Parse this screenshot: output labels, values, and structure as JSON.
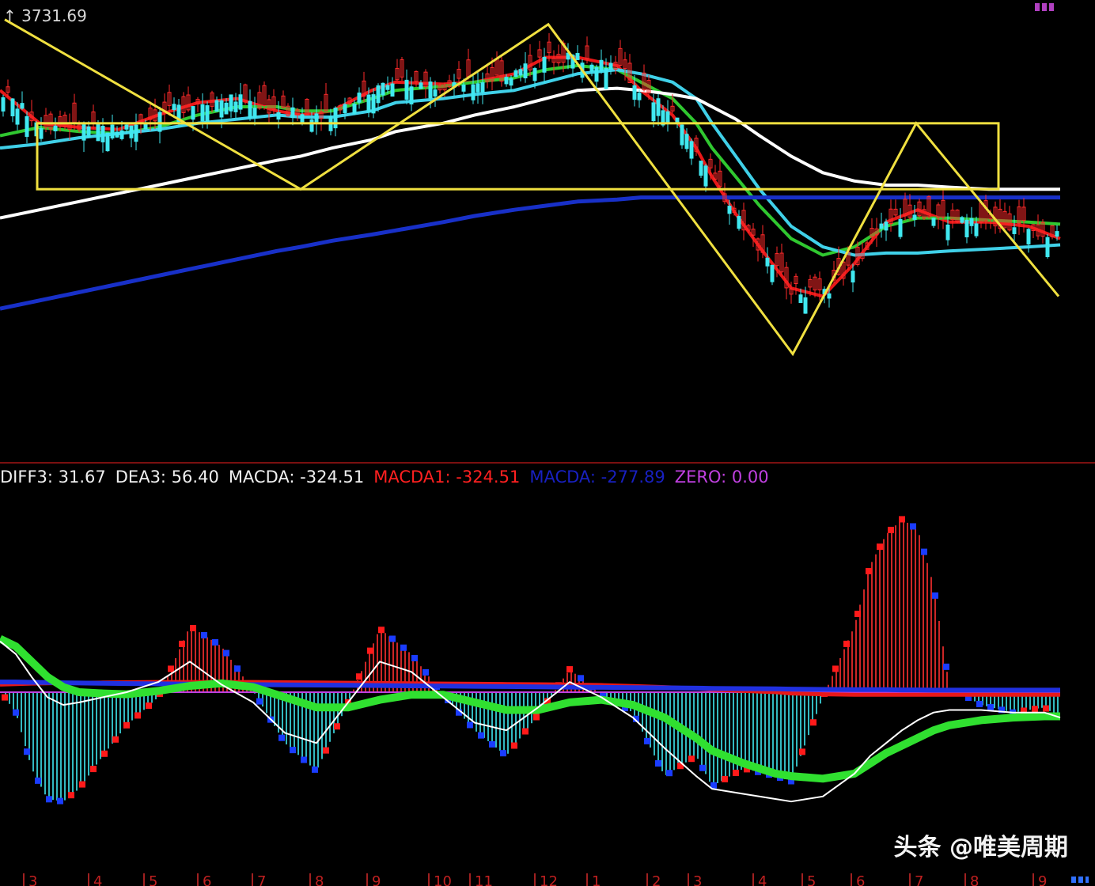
{
  "price_panel": {
    "max_label": "3731.69"
  },
  "macd_header": [
    {
      "key": "diff3",
      "text": "DIFF3: 31.67",
      "color": "#f0f0f0"
    },
    {
      "key": "dea3",
      "text": "DEA3: 56.40",
      "color": "#f0f0f0"
    },
    {
      "key": "macda",
      "text": "MACDA: -324.51",
      "color": "#f0f0f0"
    },
    {
      "key": "macda1",
      "text": "MACDA1: -324.51",
      "color": "#ff2020"
    },
    {
      "key": "macda2",
      "text": "MACDA: -277.89",
      "color": "#1820c0"
    },
    {
      "key": "zero",
      "text": "ZERO: 0.00",
      "color": "#c040e0"
    }
  ],
  "x_axis": {
    "month_labels": [
      "3",
      "4",
      "5",
      "6",
      "7",
      "8",
      "9",
      "10",
      "11",
      "12",
      "1",
      "2",
      "3",
      "4",
      "5",
      "6",
      "7",
      "8",
      "9"
    ]
  },
  "watermark": "头条 @唯美周期",
  "colors": {
    "background": "#000000",
    "up_candle": "#ff2a2a",
    "down_candle": "#40e8f0",
    "trendline": "#f0e040",
    "ma_red": "#e81818",
    "ma_green": "#30c830",
    "ma_cyan": "#40d0e8",
    "ma_white": "#ffffff",
    "ma_blue": "#1830c8",
    "macd_up": "#ff3030",
    "macd_down": "#40e8f0"
  },
  "chart_data": [
    {
      "type": "line",
      "title": "",
      "panel": "price",
      "xlabel": "",
      "ylabel": "",
      "y_max_label": 3731.69,
      "ylim": [
        2800,
        3760
      ],
      "x": [
        0,
        50,
        100,
        150,
        200,
        250,
        300,
        350,
        380,
        420,
        470,
        500,
        560,
        600,
        650,
        690,
        730,
        780,
        810,
        850,
        880,
        900,
        930,
        960,
        1000,
        1040,
        1080,
        1120,
        1160,
        1200,
        1250,
        1300,
        1340
      ],
      "series": [
        {
          "name": "",
          "color": "#e81818",
          "values": [
            3560,
            3480,
            3470,
            3465,
            3500,
            3530,
            3540,
            3510,
            3500,
            3510,
            3560,
            3580,
            3575,
            3580,
            3600,
            3640,
            3640,
            3620,
            3560,
            3500,
            3420,
            3350,
            3260,
            3180,
            3080,
            3060,
            3140,
            3240,
            3270,
            3240,
            3240,
            3230,
            3200
          ]
        },
        {
          "name": "",
          "color": "#30c830",
          "values": [
            3450,
            3470,
            3460,
            3455,
            3470,
            3500,
            3520,
            3520,
            3510,
            3510,
            3540,
            3560,
            3570,
            3580,
            3590,
            3610,
            3620,
            3610,
            3580,
            3540,
            3480,
            3420,
            3350,
            3280,
            3200,
            3160,
            3180,
            3230,
            3250,
            3250,
            3245,
            3240,
            3235
          ]
        },
        {
          "name": "",
          "color": "#40d0e8",
          "values": [
            3420,
            3430,
            3445,
            3455,
            3465,
            3480,
            3490,
            3500,
            3495,
            3495,
            3510,
            3530,
            3540,
            3550,
            3560,
            3580,
            3600,
            3610,
            3600,
            3580,
            3540,
            3480,
            3400,
            3320,
            3230,
            3180,
            3160,
            3165,
            3165,
            3170,
            3175,
            3180,
            3185
          ]
        },
        {
          "name": "",
          "color": "#ffffff",
          "values": [
            3250,
            3270,
            3290,
            3310,
            3330,
            3350,
            3370,
            3390,
            3400,
            3420,
            3440,
            3460,
            3480,
            3500,
            3520,
            3540,
            3560,
            3565,
            3560,
            3550,
            3540,
            3520,
            3490,
            3450,
            3400,
            3360,
            3340,
            3330,
            3330,
            3325,
            3320,
            3320,
            3320
          ]
        },
        {
          "name": "",
          "color": "#1830c8",
          "values": [
            3030,
            3050,
            3070,
            3090,
            3110,
            3130,
            3150,
            3170,
            3180,
            3195,
            3210,
            3220,
            3240,
            3255,
            3270,
            3280,
            3290,
            3295,
            3300,
            3300,
            3300,
            3300,
            3300,
            3300,
            3300,
            3300,
            3300,
            3300,
            3300,
            3300,
            3300,
            3300,
            3300
          ]
        }
      ],
      "trendline_zigzag": {
        "x": [
          6,
          380,
          693,
          1002,
          1158,
          1338
        ],
        "y": [
          3731.69,
          3320,
          3720,
          2920,
          3480,
          3060
        ]
      },
      "box": {
        "x": [
          47,
          1262
        ],
        "y": [
          3320,
          3480
        ]
      }
    },
    {
      "type": "bar",
      "title": "",
      "panel": "macd",
      "xlabel": "",
      "ylabel": "",
      "ylim": [
        -700,
        700
      ],
      "x": [
        0,
        20,
        40,
        60,
        80,
        100,
        130,
        160,
        200,
        240,
        280,
        320,
        360,
        400,
        440,
        480,
        520,
        560,
        600,
        640,
        680,
        720,
        760,
        800,
        840,
        880,
        900,
        940,
        980,
        1000,
        1040,
        1080,
        1100,
        1120,
        1140,
        1160,
        1180,
        1200,
        1240,
        1280,
        1320,
        1340
      ],
      "histogram": [
        5,
        -80,
        -300,
        -420,
        -430,
        -380,
        -250,
        -130,
        -20,
        260,
        180,
        5,
        -200,
        -310,
        -40,
        250,
        150,
        -10,
        -150,
        -250,
        -90,
        90,
        -10,
        -80,
        -330,
        -250,
        -370,
        -300,
        -330,
        -350,
        -20,
        260,
        500,
        620,
        680,
        640,
        420,
        20,
        -50,
        -80,
        -60,
        -100
      ],
      "diff_line": [
        200,
        150,
        60,
        -20,
        -50,
        -40,
        -20,
        0,
        40,
        120,
        30,
        -40,
        -160,
        -200,
        -40,
        120,
        80,
        -20,
        -120,
        -150,
        -60,
        40,
        -20,
        -100,
        -220,
        -330,
        -380,
        -400,
        -420,
        -430,
        -410,
        -320,
        -250,
        -200,
        -150,
        -110,
        -80,
        -70,
        -70,
        -80,
        -80,
        -100
      ],
      "dea_line": [
        210,
        180,
        120,
        60,
        20,
        0,
        -5,
        -8,
        5,
        25,
        35,
        20,
        -20,
        -60,
        -60,
        -30,
        -10,
        -10,
        -40,
        -70,
        -70,
        -40,
        -30,
        -50,
        -100,
        -180,
        -230,
        -280,
        -320,
        -330,
        -340,
        -320,
        -280,
        -240,
        -210,
        -180,
        -150,
        -130,
        -110,
        -100,
        -95,
        -95
      ],
      "macda1_line": [
        30,
        32,
        34,
        35,
        36,
        37,
        38,
        39,
        40,
        40,
        40,
        40,
        39,
        38,
        37,
        36,
        35,
        34,
        33,
        32,
        31,
        30,
        28,
        24,
        20,
        15,
        10,
        5,
        0,
        -5,
        -8,
        -10,
        -10,
        -10,
        -10,
        -10,
        -10,
        -10,
        -10,
        -10,
        -10,
        -10
      ],
      "macda2_line": [
        40,
        40,
        39,
        38,
        37,
        36,
        35,
        34,
        33,
        32,
        31,
        30,
        29,
        28,
        27,
        26,
        25,
        24,
        23,
        22,
        21,
        20,
        19,
        18,
        17,
        16,
        15,
        14,
        13,
        12,
        11,
        10,
        10,
        10,
        9,
        9,
        8,
        8,
        8,
        8,
        8,
        8
      ],
      "zero": 0
    }
  ]
}
